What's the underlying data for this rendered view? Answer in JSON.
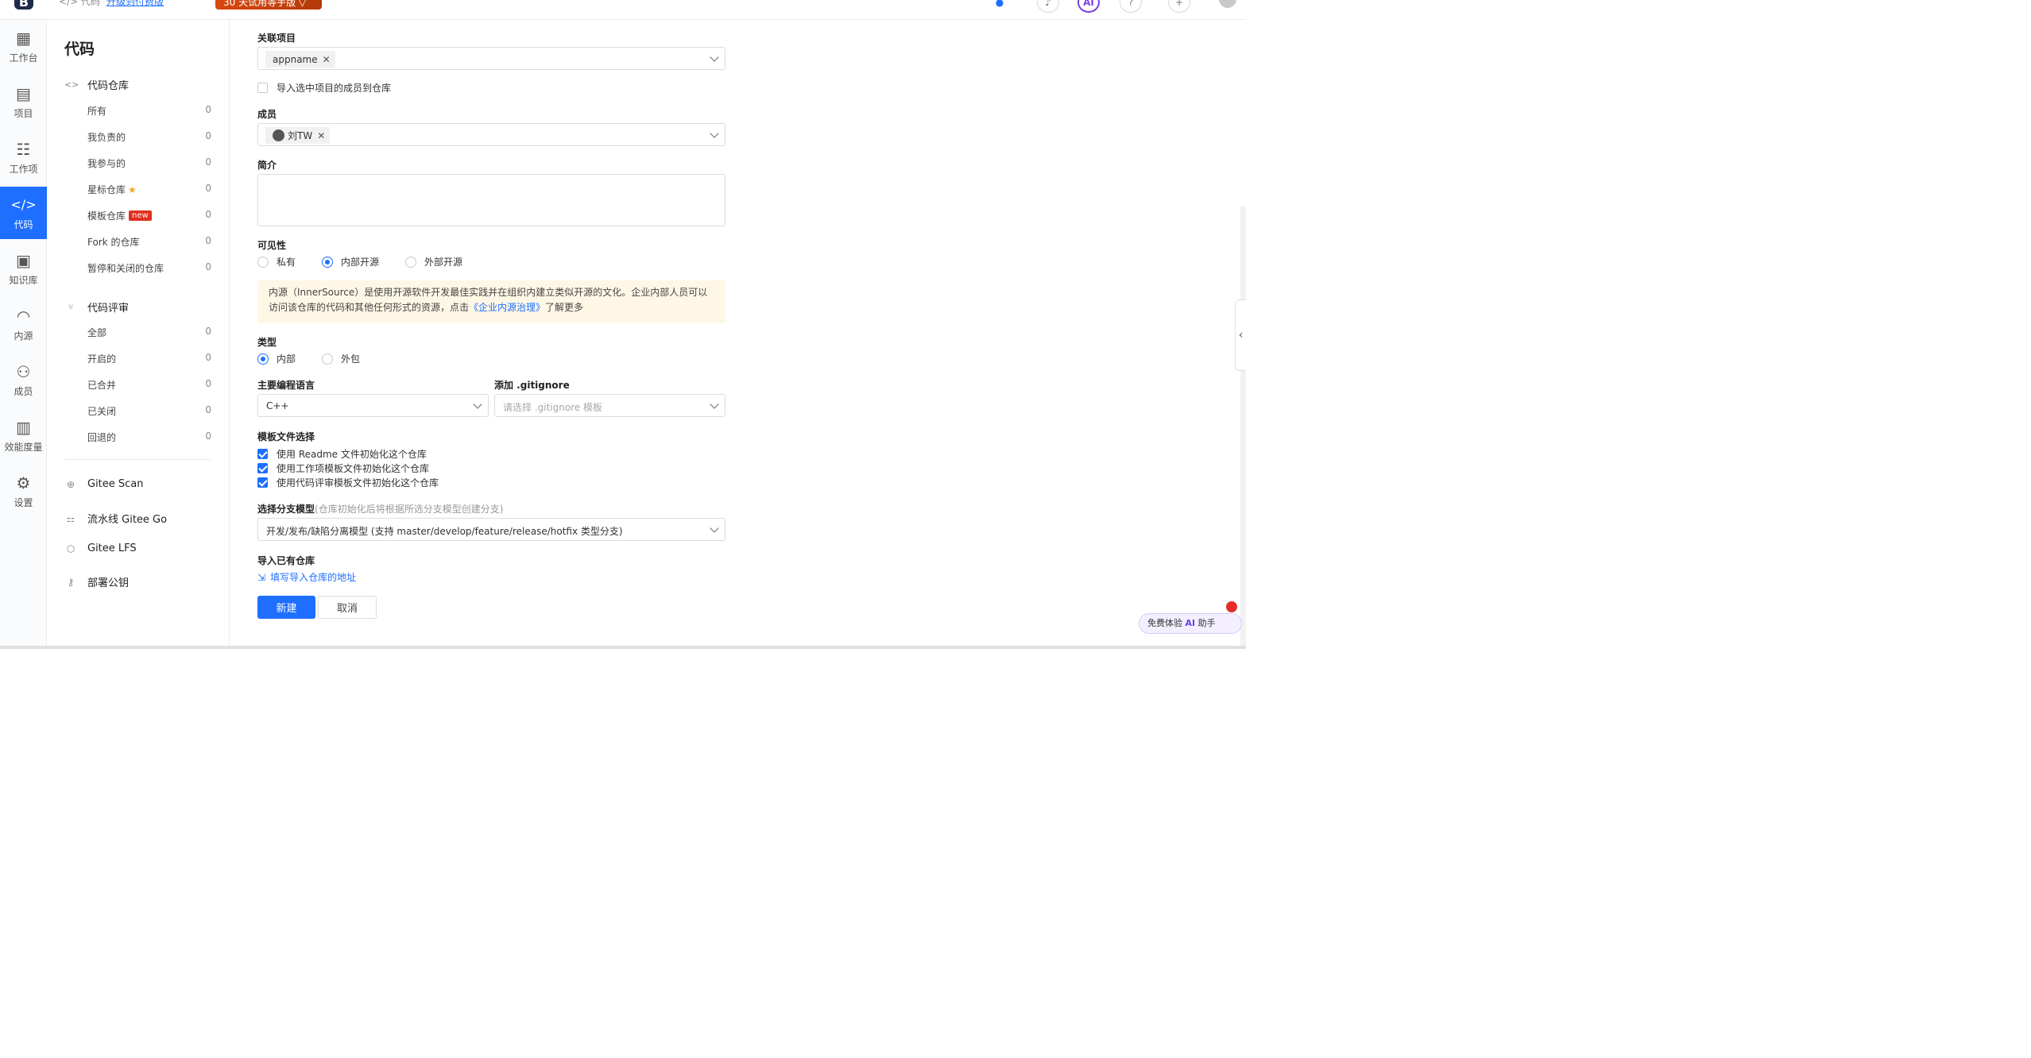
{
  "topbar": {
    "logo": "B",
    "crumb": "</> 代码",
    "upgrade_link": "升级到付费版",
    "trial_badge": "30 天试用等手版 ▽",
    "icons": [
      "notification-icon",
      "bell-icon",
      "ai-icon",
      "help-icon",
      "plus-icon"
    ],
    "ai_label": "AI"
  },
  "rail": {
    "items": [
      {
        "label": "工作台",
        "icon": "dashboard-icon",
        "glyph": "▦"
      },
      {
        "label": "项目",
        "icon": "project-icon",
        "glyph": "▤"
      },
      {
        "label": "工作项",
        "icon": "task-icon",
        "glyph": "☷"
      },
      {
        "label": "代码",
        "icon": "code-icon",
        "glyph": "</>"
      },
      {
        "label": "知识库",
        "icon": "wiki-icon",
        "glyph": "▣"
      },
      {
        "label": "内源",
        "icon": "innersource-icon",
        "glyph": "◠"
      },
      {
        "label": "成员",
        "icon": "members-icon",
        "glyph": "⚇"
      },
      {
        "label": "效能度量",
        "icon": "metrics-icon",
        "glyph": "▥"
      },
      {
        "label": "设置",
        "icon": "settings-icon",
        "glyph": "⚙"
      }
    ],
    "active": "代码"
  },
  "sidebar": {
    "title": "代码",
    "repo_group": "代码仓库",
    "repo_items": [
      {
        "label": "所有",
        "count": "0"
      },
      {
        "label": "我负责的",
        "count": "0"
      },
      {
        "label": "我参与的",
        "count": "0"
      },
      {
        "label": "星标仓库",
        "count": "0"
      },
      {
        "label": "模板仓库",
        "count": "0"
      },
      {
        "label": "Fork 的仓库",
        "count": "0"
      },
      {
        "label": "暂停和关闭的仓库",
        "count": "0"
      }
    ],
    "new_badge": "new",
    "review_group": "代码评审",
    "review_items": [
      {
        "label": "全部",
        "count": "0"
      },
      {
        "label": "开启的",
        "count": "0"
      },
      {
        "label": "已合并",
        "count": "0"
      },
      {
        "label": "已关闭",
        "count": "0"
      },
      {
        "label": "回退的",
        "count": "0"
      }
    ],
    "tools": [
      "Gitee Scan",
      "流水线 Gitee Go",
      "Gitee LFS",
      "部署公钥"
    ]
  },
  "form": {
    "project_label": "关联项目",
    "project_tag": "appname",
    "import_members_label": "导入选中项目的成员到仓库",
    "members_label": "成员",
    "member_tag": "刘TW",
    "intro_label": "简介",
    "intro_value": "",
    "visibility_label": "可见性",
    "visibility_options": [
      "私有",
      "内部开源",
      "外部开源"
    ],
    "visibility_selected": "内部开源",
    "notice_text_1": "内源（InnerSource）是使用开源软件开发最佳实践并在组织内建立类似开源的文化。企业内部人员可以访问该仓库的代码和其他任何形式的资源，点击",
    "notice_link": "《企业内源治理》",
    "notice_text_2": "了解更多",
    "type_label": "类型",
    "type_options": [
      "内部",
      "外包"
    ],
    "type_selected": "内部",
    "language_label": "主要编程语言",
    "language_value": "C++",
    "gitignore_label": "添加 .gitignore",
    "gitignore_placeholder": "请选择 .gitignore 模板",
    "template_label": "模板文件选择",
    "template_options": [
      {
        "label": "使用 Readme 文件初始化这个仓库",
        "checked": true
      },
      {
        "label": "使用工作项模板文件初始化这个仓库",
        "checked": true
      },
      {
        "label": "使用代码评审模板文件初始化这个仓库",
        "checked": true
      }
    ],
    "branch_label": "选择分支模型",
    "branch_hint": "(仓库初始化后将根据所选分支模型创建分支)",
    "branch_value": "开发/发布/缺陷分离模型 (支持 master/develop/feature/release/hotfix 类型分支)",
    "import_label": "导入已有仓库",
    "import_link": "填写导入仓库的地址",
    "create_button": "新建",
    "cancel_button": "取消"
  },
  "ai_helper": {
    "text_1": "免费体验 ",
    "ai": "AI",
    "text_2": " 助手"
  },
  "colors": {
    "primary": "#1e6fff",
    "notice_bg": "#fff7e6",
    "new_badge": "#e0301e",
    "star": "#f5a623"
  }
}
